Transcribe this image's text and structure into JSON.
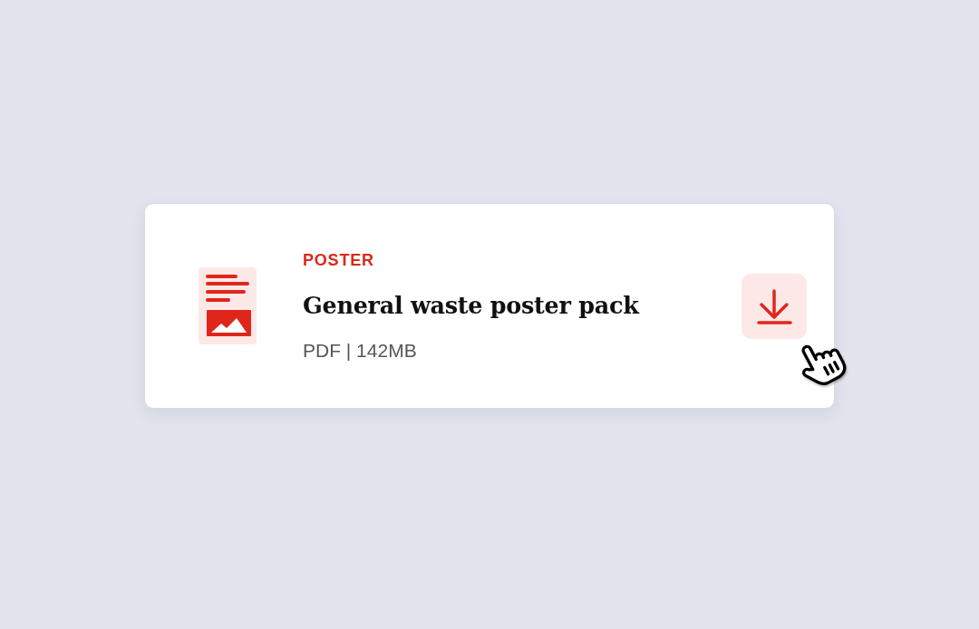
{
  "card": {
    "category": "POSTER",
    "title": "General waste poster pack",
    "meta": "PDF | 142MB"
  }
}
